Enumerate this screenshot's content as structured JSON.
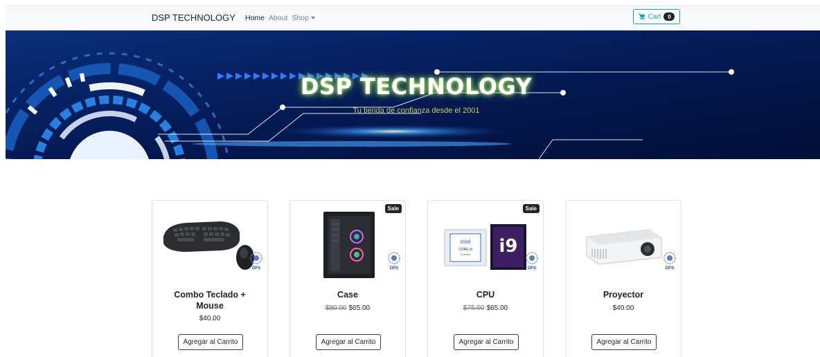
{
  "navbar": {
    "brand": "DSP TECHNOLOGY",
    "links": [
      "Home",
      "About",
      "Shop"
    ],
    "cart_label": "Cart",
    "cart_count": "0",
    "accent_color": "#17a2b8"
  },
  "hero": {
    "title": "DSP TECHNOLOGY",
    "subtitle": "Tu tienda de confianza desde el 2001"
  },
  "products": [
    {
      "name": "Combo Teclado + Mouse",
      "old_price": "",
      "price": "$40.00",
      "sale_badge": "",
      "button": "Agregar al Carrito",
      "image_icon": "keyboard-mouse-image"
    },
    {
      "name": "Case",
      "old_price": "$80.00",
      "price": "$65.00",
      "sale_badge": "Sale",
      "button": "Agregar al Carrito",
      "image_icon": "pc-case-image"
    },
    {
      "name": "CPU",
      "old_price": "$75.00",
      "price": "$65.00",
      "sale_badge": "Sale",
      "button": "Agregar al Carrito",
      "image_icon": "cpu-box-image"
    },
    {
      "name": "Proyector",
      "old_price": "",
      "price": "$40.00",
      "sale_badge": "",
      "button": "Agregar al Carrito",
      "image_icon": "projector-image"
    }
  ]
}
